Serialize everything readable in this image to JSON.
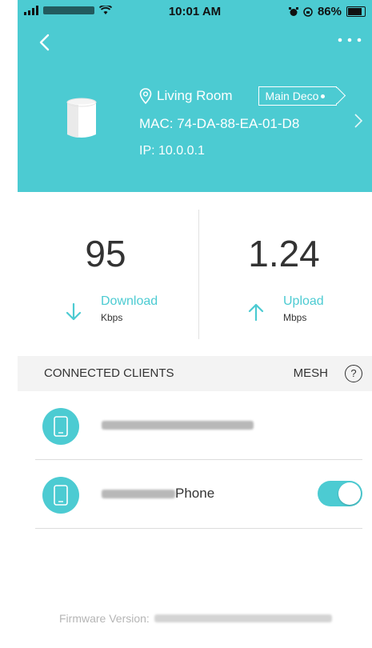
{
  "status_bar": {
    "time": "10:01 AM",
    "battery": "86%"
  },
  "device": {
    "location": "Living Room",
    "role_tag": "Main Deco",
    "mac": "MAC: 74-DA-88-EA-01-D8",
    "ip": "IP: 10.0.0.1"
  },
  "stats": {
    "download": {
      "value": "95",
      "label": "Download",
      "unit": "Kbps"
    },
    "upload": {
      "value": "1.24",
      "label": "Upload",
      "unit": "Mbps"
    }
  },
  "clients_section": {
    "title": "CONNECTED CLIENTS",
    "mesh_label": "MESH",
    "help": "?"
  },
  "clients": [
    {
      "name_suffix": "",
      "toggle": false
    },
    {
      "name_suffix": "Phone",
      "toggle": true
    }
  ],
  "firmware": {
    "label": "Firmware Version:"
  },
  "colors": {
    "accent": "#4ccbd2"
  },
  "icons": [
    "back-icon",
    "more-icon",
    "location-pin-icon",
    "chevron-right-icon",
    "download-arrow-icon",
    "upload-arrow-icon",
    "phone-device-icon",
    "help-icon"
  ]
}
